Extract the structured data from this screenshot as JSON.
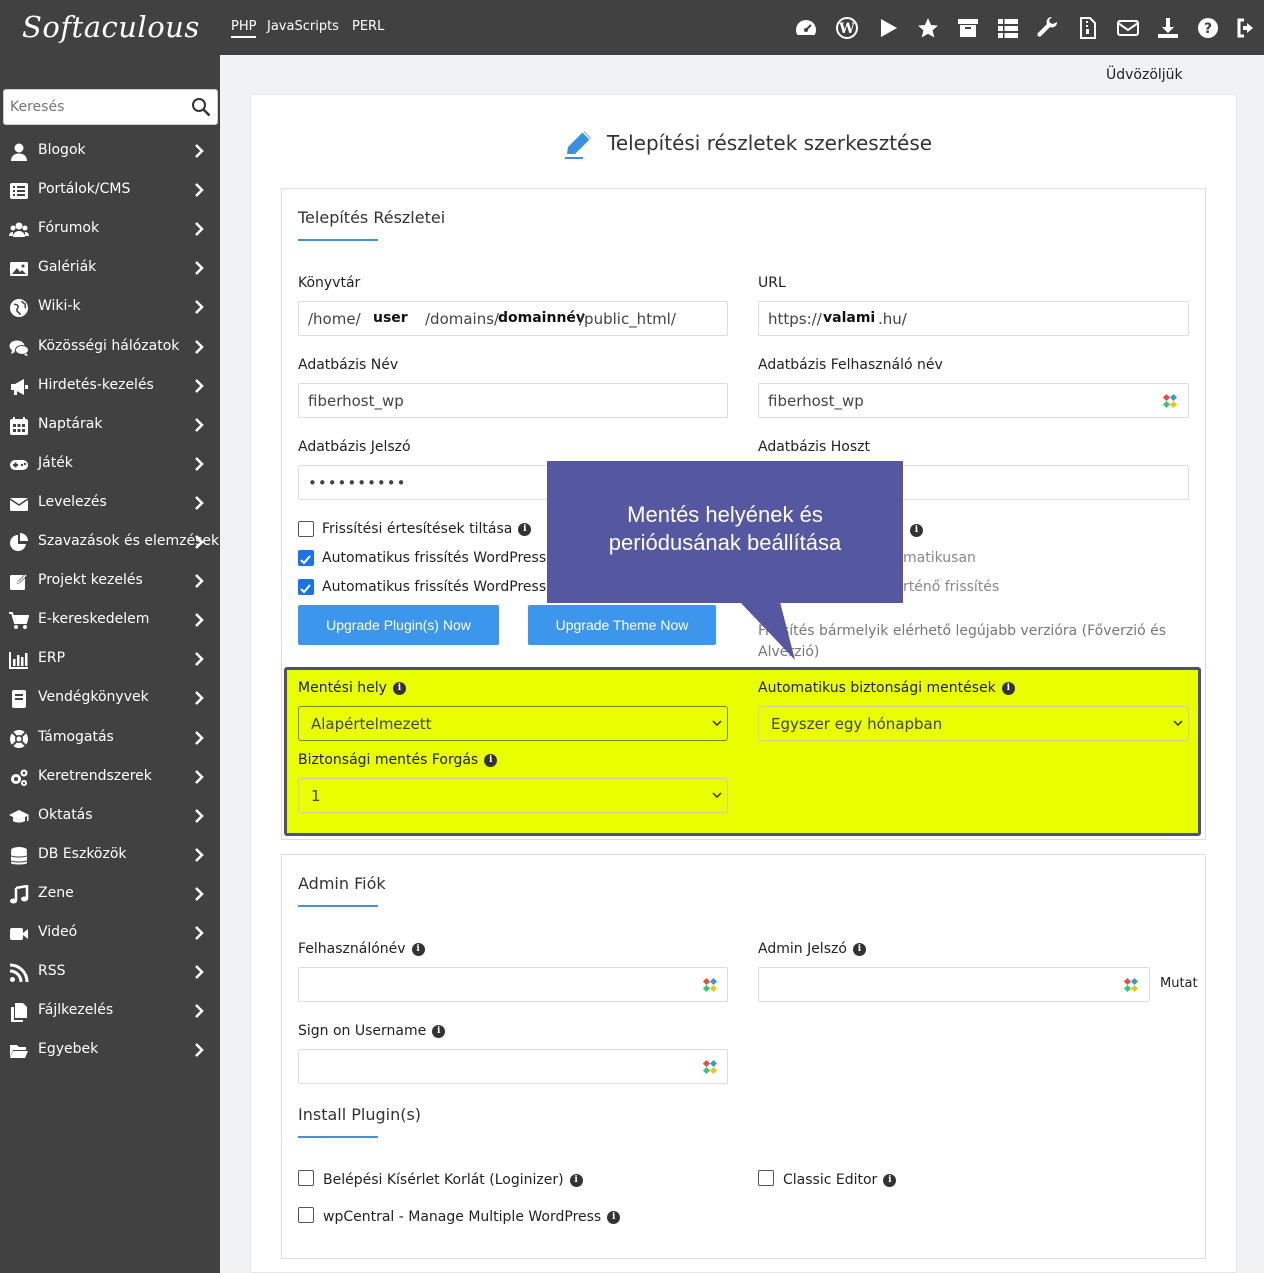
{
  "topbar": {
    "logo": "Softaculous",
    "tabs": [
      "PHP",
      "JavaScripts",
      "PERL"
    ],
    "icons": [
      "dashboard-icon",
      "wordpress-icon",
      "play-icon",
      "star-icon",
      "archive-icon",
      "list-icon",
      "wrench-icon",
      "file-icon",
      "mail-icon",
      "download-icon",
      "help-icon",
      "logout-icon"
    ]
  },
  "sidebar": {
    "search_placeholder": "Keresés",
    "items": [
      {
        "label": "Blogok",
        "icon": "user-icon"
      },
      {
        "label": "Portálok/CMS",
        "icon": "list-icon"
      },
      {
        "label": "Fórumok",
        "icon": "users-icon"
      },
      {
        "label": "Galériák",
        "icon": "image-icon"
      },
      {
        "label": "Wiki-k",
        "icon": "globe-icon"
      },
      {
        "label": "Közösségi hálózatok",
        "icon": "comments-icon"
      },
      {
        "label": "Hirdetés-kezelés",
        "icon": "megaphone-icon"
      },
      {
        "label": "Naptárak",
        "icon": "calendar-icon"
      },
      {
        "label": "Játék",
        "icon": "gamepad-icon"
      },
      {
        "label": "Levelezés",
        "icon": "envelope-icon"
      },
      {
        "label": "Szavazások és elemzések",
        "icon": "pie-chart-icon"
      },
      {
        "label": "Projekt kezelés",
        "icon": "edit-icon"
      },
      {
        "label": "E-kereskedelem",
        "icon": "cart-icon"
      },
      {
        "label": "ERP",
        "icon": "bar-chart-icon"
      },
      {
        "label": "Vendégkönyvek",
        "icon": "book-icon"
      },
      {
        "label": "Támogatás",
        "icon": "lifebuoy-icon"
      },
      {
        "label": "Keretrendszerek",
        "icon": "cogs-icon"
      },
      {
        "label": "Oktatás",
        "icon": "graduation-icon"
      },
      {
        "label": "DB Eszközök",
        "icon": "database-icon"
      },
      {
        "label": "Zene",
        "icon": "music-icon"
      },
      {
        "label": "Videó",
        "icon": "video-icon"
      },
      {
        "label": "RSS",
        "icon": "rss-icon"
      },
      {
        "label": "Fájlkezelés",
        "icon": "files-icon"
      },
      {
        "label": "Egyebek",
        "icon": "folder-icon"
      }
    ]
  },
  "header": {
    "welcome": "Üdvözöljük",
    "title": "Telepítési részletek szerkesztése"
  },
  "install": {
    "section_title": "Telepítés Részletei",
    "dir_label": "Könyvtár",
    "dir_parts": [
      "/home/",
      "user",
      "/domains/",
      "domainnév",
      "/public_html/"
    ],
    "url_label": "URL",
    "url_parts": [
      "https://",
      "valami",
      ".hu/"
    ],
    "dbname_label": "Adatbázis Név",
    "dbname_value": "fiberhost_wp",
    "dbuser_label": "Adatbázis Felhasználó név",
    "dbuser_value": "fiberhost_wp",
    "dbpass_label": "Adatbázis Jelszó",
    "dbpass_value": "••••••••••",
    "dbhost_label": "Adatbázis Hoszt",
    "cb_disable_updates": "Frissítési értesítések tiltása",
    "cb_auto_plugins": "Automatikus frissítés WordPress",
    "cb_auto_themes": "Automatikus frissítés WordPress",
    "right_text_1": "matikusan",
    "right_text_2": "rténő frissítés",
    "upgrade_plugins": "Upgrade Plugin(s) Now",
    "upgrade_theme": "Upgrade Theme Now",
    "update_note": "Frissítés bármelyik elérhető legújabb verzióra (Főverzió és Alverzió)"
  },
  "callout": {
    "line1": "Mentés helyének és",
    "line2": "periódusának beállítása"
  },
  "backup": {
    "location_label": "Mentési hely",
    "location_value": "Alapértelmezett",
    "auto_label": "Automatikus biztonsági mentések",
    "auto_value": "Egyszer egy hónapban",
    "rotation_label": "Biztonsági mentés Forgás",
    "rotation_value": "1"
  },
  "admin": {
    "section_title": "Admin Fiók",
    "username_label": "Felhasználónév",
    "password_label": "Admin Jelszó",
    "show_label": "Mutat",
    "signon_label": "Sign on Username"
  },
  "plugins": {
    "section_title": "Install Plugin(s)",
    "loginizer": "Belépési Kísérlet Korlát (Loginizer)",
    "classic_editor": "Classic Editor",
    "wpcentral": "wpCentral - Manage Multiple WordPress"
  },
  "colors": {
    "topbar": "#414141",
    "accent": "#3c96ec",
    "highlight": "#e9ff00",
    "callout": "#5557a0",
    "checkbox": "#1a73e8"
  }
}
